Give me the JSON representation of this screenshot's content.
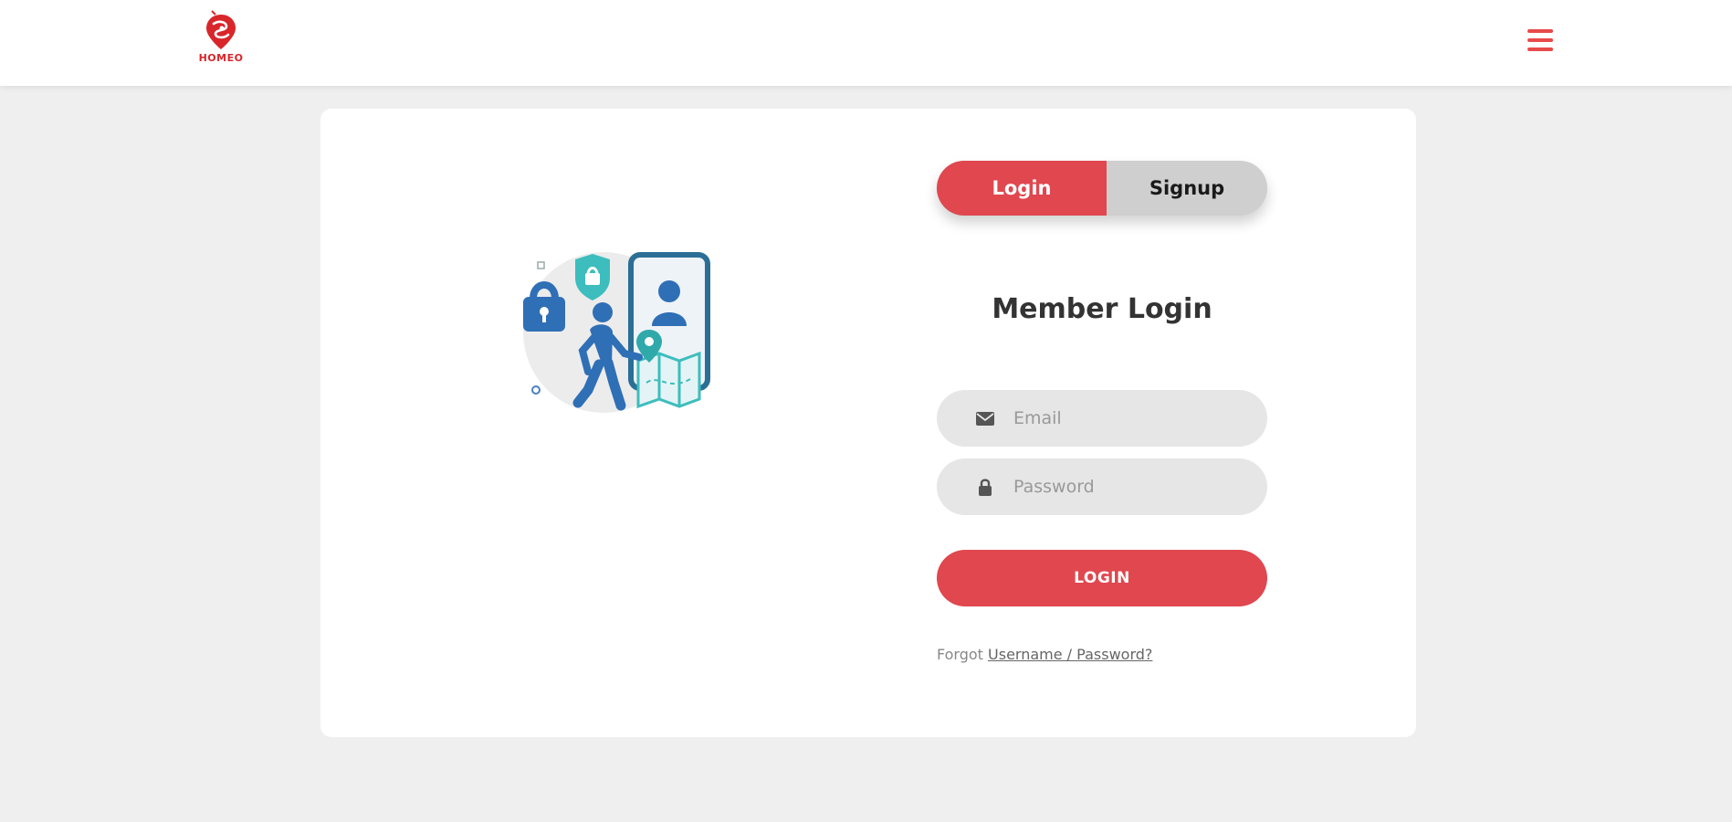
{
  "header": {
    "logo_text": "HOMEO",
    "menu_icon": "hamburger-menu-icon",
    "accent_color": "#e84a4a"
  },
  "auth": {
    "tabs": {
      "login_label": "Login",
      "signup_label": "Signup",
      "active": "login"
    },
    "title": "Member Login",
    "email": {
      "placeholder": "Email",
      "value": "",
      "icon": "envelope-icon"
    },
    "password": {
      "placeholder": "Password",
      "value": "",
      "icon": "lock-icon"
    },
    "submit_label": "LOGIN",
    "forgot_prefix": "Forgot",
    "forgot_link": "Username / Password?",
    "primary_color": "#e0474f"
  },
  "illustration": {
    "icon": "secure-access-illustration"
  }
}
